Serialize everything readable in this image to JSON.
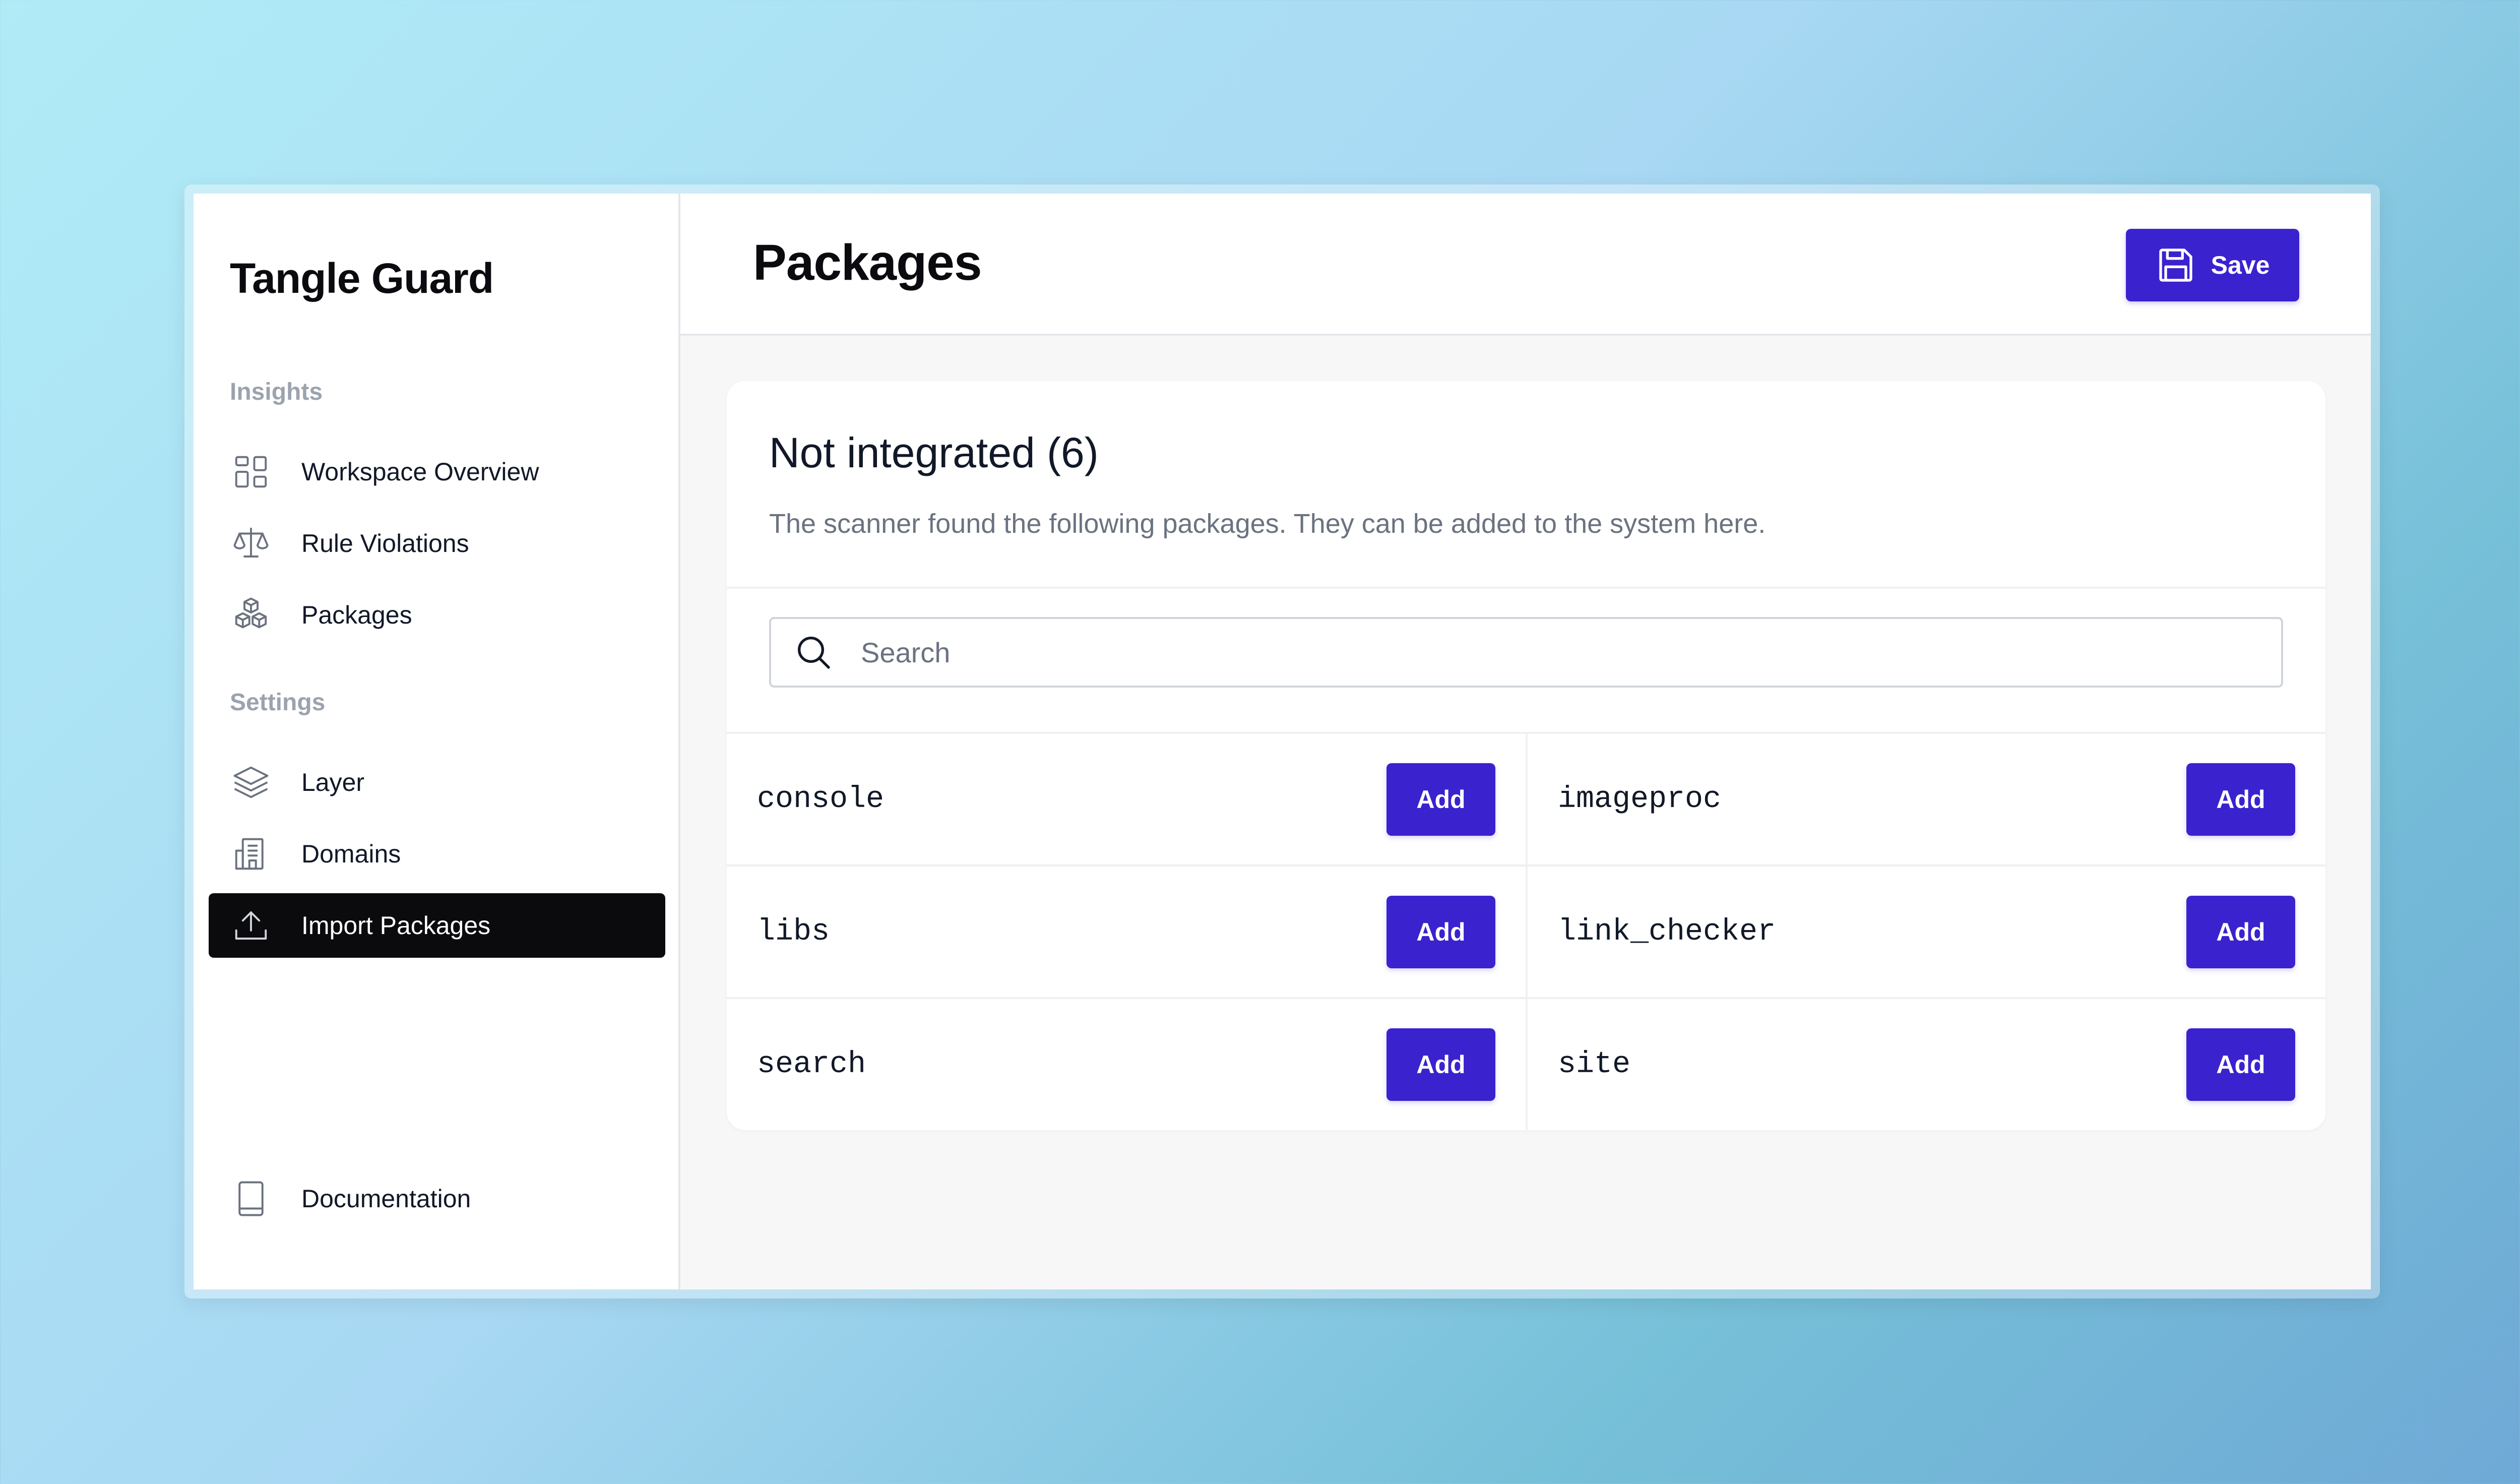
{
  "sidebar": {
    "brand": "Tangle Guard",
    "sections": [
      {
        "label": "Insights",
        "items": [
          {
            "label": "Workspace Overview",
            "icon": "grid-icon"
          },
          {
            "label": "Rule Violations",
            "icon": "scale-icon"
          },
          {
            "label": "Packages",
            "icon": "cubes-icon"
          }
        ]
      },
      {
        "label": "Settings",
        "items": [
          {
            "label": "Layer",
            "icon": "layers-icon"
          },
          {
            "label": "Domains",
            "icon": "building-icon"
          },
          {
            "label": "Import Packages",
            "icon": "upload-icon",
            "active": true
          }
        ]
      }
    ],
    "footer_item": {
      "label": "Documentation",
      "icon": "book-icon"
    }
  },
  "header": {
    "title": "Packages",
    "save_label": "Save"
  },
  "card": {
    "title": "Not integrated (6)",
    "description": "The scanner found the following packages. They can be added to the system here.",
    "search_placeholder": "Search",
    "add_label": "Add",
    "packages": [
      "console",
      "imageproc",
      "libs",
      "link_checker",
      "search",
      "site"
    ]
  },
  "colors": {
    "accent": "#3b22cf",
    "sidebar_active_bg": "#0b0b0d"
  }
}
